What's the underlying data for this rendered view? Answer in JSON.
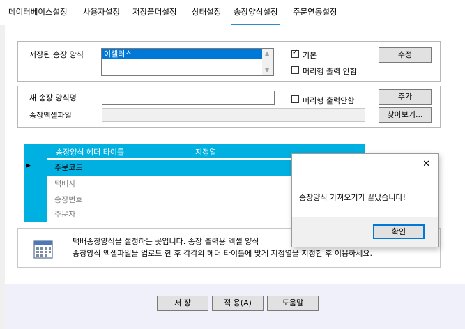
{
  "tabs": [
    {
      "label": "데이터베이스설정"
    },
    {
      "label": "사용자설정"
    },
    {
      "label": "저장폴더설정"
    },
    {
      "label": "상태설정"
    },
    {
      "label": "송장양식설정"
    },
    {
      "label": "주문연동설정"
    }
  ],
  "saved_form": {
    "label": "저장된 송장 양식",
    "selected_item": "이셀러스",
    "basic_label": "기본",
    "basic_checked": true,
    "no_header_label": "머리행 출력 안함",
    "no_header_checked": false,
    "edit_button": "수정"
  },
  "new_form": {
    "name_label": "새 송장 양식명",
    "name_value": "",
    "file_label": "송장엑셀파일",
    "file_value": "",
    "no_header_label": "머리행 출력안함",
    "no_header_checked": false,
    "add_button": "추가",
    "browse_button": "찾아보기..."
  },
  "grid": {
    "col1": "송장양식 헤더 타이틀",
    "col2": "지정열",
    "rows": [
      "주문코드",
      "택배사",
      "송장번호",
      "주문자"
    ]
  },
  "info": {
    "line1": "택배송장양식을 설정하는 곳입니다. 송장 출력용 엑셀 양식",
    "line2": "송장양식 엑셀파일을 업로드 한 후 각각의 헤더 타이틀에 맞게 지정열을 지정한 후 이용하세요."
  },
  "footer": {
    "save": "저 장",
    "apply": "적 용(A)",
    "help": "도움말"
  },
  "dialog": {
    "message": "송장양식 가져오기가 끝났습니다!",
    "ok": "확인",
    "close_glyph": "✕"
  }
}
